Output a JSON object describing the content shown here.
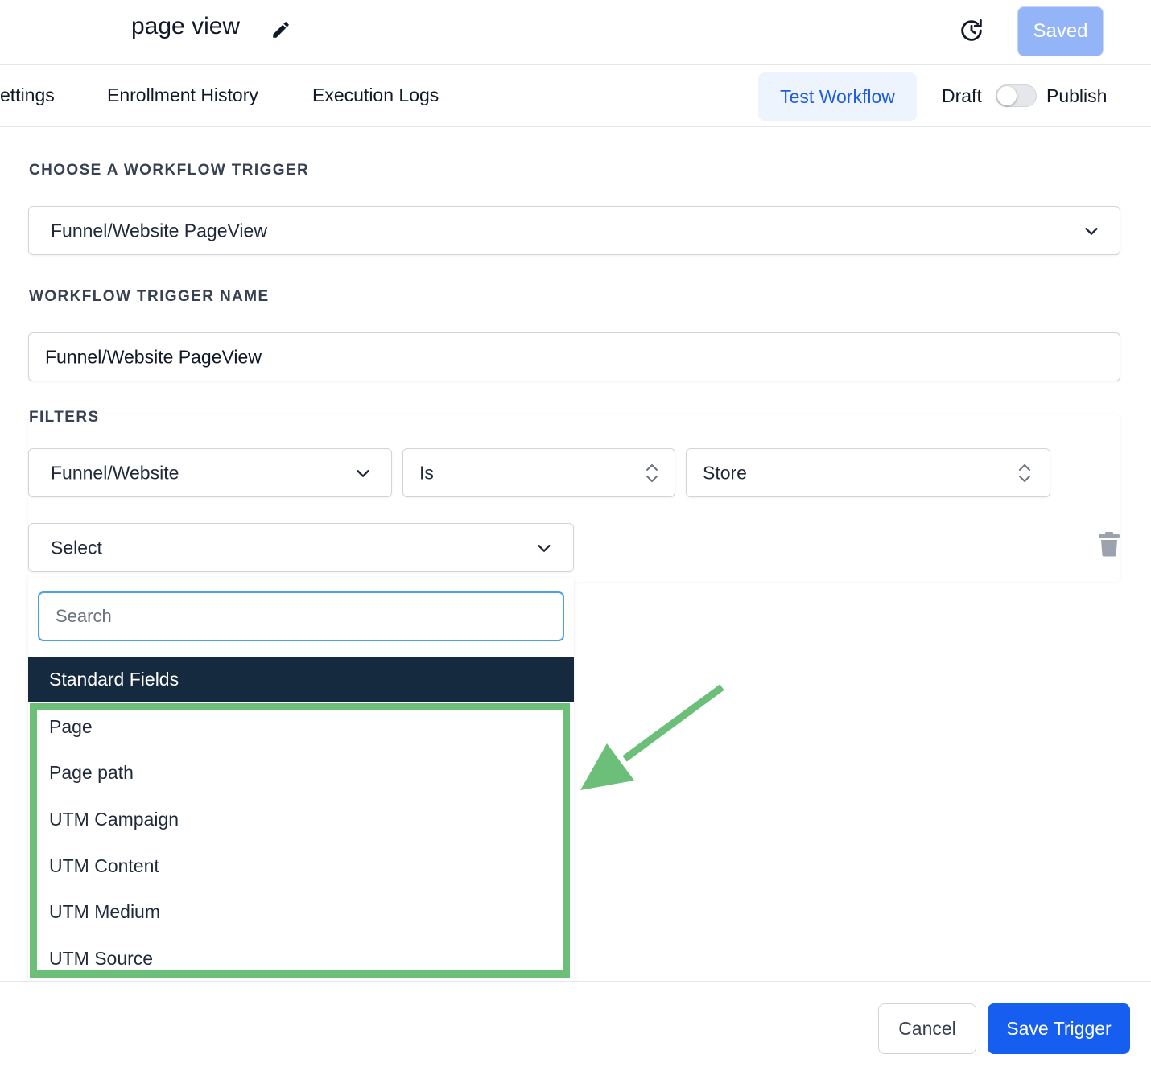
{
  "header": {
    "title": "page view",
    "saved_label": "Saved"
  },
  "tabs": {
    "settings": "ettings",
    "enrollment_history": "Enrollment History",
    "execution_logs": "Execution Logs",
    "test_workflow": "Test Workflow",
    "draft_label": "Draft",
    "publish_label": "Publish",
    "publish_toggle_on": false
  },
  "trigger": {
    "choose_label": "CHOOSE A WORKFLOW TRIGGER",
    "selected_trigger": "Funnel/Website PageView",
    "name_label": "WORKFLOW TRIGGER NAME",
    "name_value": "Funnel/Website PageView"
  },
  "filters": {
    "label": "FILTERS",
    "field": "Funnel/Website",
    "operator": "Is",
    "value": "Store",
    "new_field_select": "Select"
  },
  "dropdown": {
    "search_placeholder": "Search",
    "group_header": "Standard Fields",
    "options": [
      "Page",
      "Page path",
      "UTM Campaign",
      "UTM Content",
      "UTM Medium",
      "UTM Source"
    ]
  },
  "footer": {
    "cancel_label": "Cancel",
    "save_label": "Save Trigger"
  },
  "colors": {
    "primary": "#155eef",
    "saved_disabled": "#93b4f7",
    "group_header_bg": "#152a3f",
    "highlight": "#6cbf79",
    "search_focus": "#4aa3e0"
  },
  "icons": [
    "pencil-icon",
    "history-clock-icon",
    "chevron-down-icon",
    "sort-updown-icon",
    "trash-icon",
    "arrow-annotation"
  ]
}
